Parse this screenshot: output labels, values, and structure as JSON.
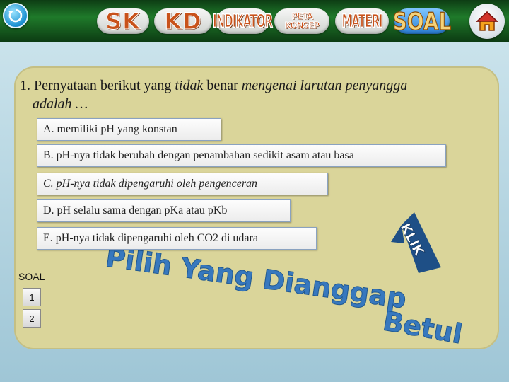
{
  "nav": {
    "sk": "SK",
    "kd": "KD",
    "indikator": "INDIKATOR",
    "peta_line1": "PETA",
    "peta_line2": "KONSEP",
    "materi": "MATERI",
    "soal": "SOAL"
  },
  "icons": {
    "back": "back-arrow-icon",
    "home": "home-icon"
  },
  "question": {
    "prefix": "1. Pernyataan berikut yang ",
    "emphasis": "tidak",
    "middle": " benar ",
    "suffix_italic": "mengenai larutan penyangga",
    "line2": "adalah …"
  },
  "options": {
    "a": "A. memiliki pH yang konstan",
    "b": "B. pH-nya tidak berubah dengan penambahan sedikit asam atau basa",
    "c": "C. pH-nya tidak dipengaruhi oleh pengenceran",
    "d": "D. pH selalu sama dengan pKa atau pKb",
    "e": "E. pH-nya tidak dipengaruhi oleh CO2 di udara"
  },
  "soal_nav": {
    "label": "SOAL",
    "items": [
      "1",
      "2"
    ]
  },
  "klik_label": "KLIK",
  "watermark": {
    "line1": "Pilih Yang Dianggap",
    "line2": "Betul"
  },
  "colors": {
    "top_bar": "#1f7a2a",
    "panel": "#dad59a",
    "klik_arrow": "#1e4f86",
    "watermark": "#2f74c0"
  }
}
